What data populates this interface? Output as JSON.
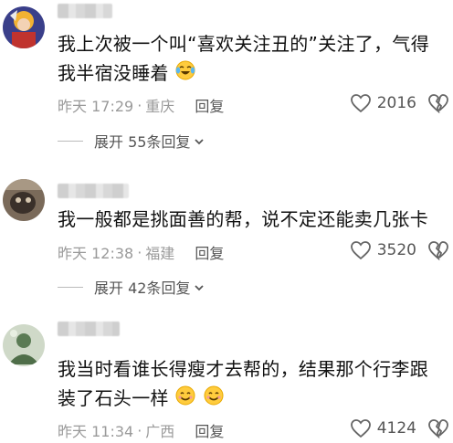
{
  "comments": [
    {
      "text": "我上次被一个叫“喜欢关注丑的”关注了，气得我半宿没睡着",
      "emoji": "laughing-crying",
      "time": "昨天 17:29",
      "location": "重庆",
      "reply_label": "回复",
      "likes": "2016",
      "expand_label": "展开 55条回复"
    },
    {
      "text": "我一般都是挑面善的帮，说不定还能卖几张卡",
      "time": "昨天 12:38",
      "location": "福建",
      "reply_label": "回复",
      "likes": "3520",
      "expand_label": "展开 42条回复"
    },
    {
      "text": "我当时看谁长得瘦才去帮的，结果那个行李跟装了石头一样",
      "emoji": "smiling",
      "time": "昨天 11:34",
      "location": "广西",
      "reply_label": "回复",
      "likes": "4124"
    }
  ],
  "separator": "·"
}
